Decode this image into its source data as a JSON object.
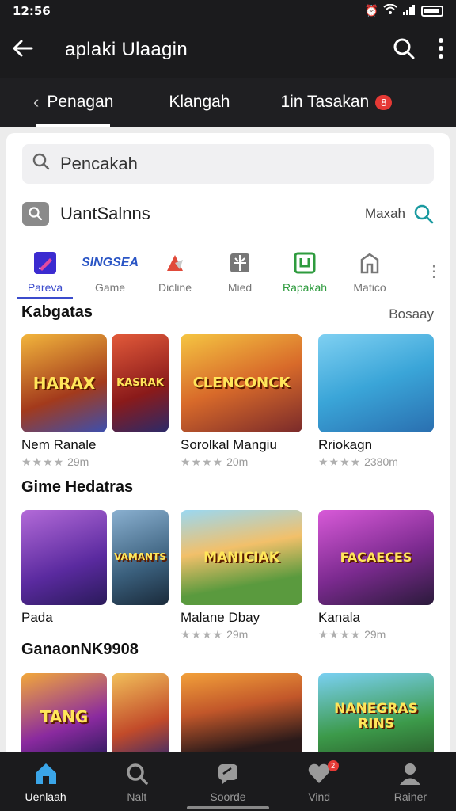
{
  "status": {
    "time": "12:56"
  },
  "app_bar": {
    "title": "aplaki Ulaagin"
  },
  "tabs": [
    {
      "label": "Penagan"
    },
    {
      "label": "Klangah"
    },
    {
      "label": "1in Tasakan",
      "badge": "8"
    }
  ],
  "search": {
    "value": "Pencakah"
  },
  "filter": {
    "label": "UantSalnns",
    "more_label": "Maxah"
  },
  "categories": [
    {
      "label": "Pareva",
      "icon": "pen-icon"
    },
    {
      "label": "Game",
      "logo": "SINGSEA"
    },
    {
      "label": "Dicline",
      "icon": "flag-icon"
    },
    {
      "label": "Mied",
      "icon": "grid-icon"
    },
    {
      "label": "Rapakah",
      "icon": "app-icon"
    },
    {
      "label": "Matico",
      "icon": "house-icon"
    }
  ],
  "sections": [
    {
      "title": "Kabgatas",
      "link": "Bosaay",
      "games": [
        {
          "name": "Nem Ranale",
          "rating": "★★★★",
          "count": "29m",
          "art": [
            "HARAX",
            "KASRAK"
          ],
          "colors": [
            "#d9882a",
            "#b42a2a"
          ]
        },
        {
          "name": "Sorolkal Mangiu",
          "rating": "★★★★",
          "count": "20m",
          "art": [
            "CLENCONCK"
          ],
          "colors": [
            "#e3a12b"
          ]
        },
        {
          "name": "Rriokagn",
          "rating": "★★★★",
          "count": "2380m",
          "art": [
            ""
          ],
          "colors": [
            "#3aa5d8"
          ]
        }
      ]
    },
    {
      "title": "Gime Hedatras",
      "link": "",
      "games": [
        {
          "name": "Pada",
          "rating": "",
          "count": "",
          "art": [
            "",
            "VAMANTS"
          ],
          "colors": [
            "#6f3bbf",
            "#3a6f9c"
          ]
        },
        {
          "name": "Malane Dbay",
          "rating": "★★★★",
          "count": "29m",
          "art": [
            "MANICIAK"
          ],
          "colors": [
            "#5a9a3e"
          ]
        },
        {
          "name": "Kanala",
          "rating": "★★★★",
          "count": "29m",
          "art": [
            "FACAECES"
          ],
          "colors": [
            "#7b2a8f"
          ]
        }
      ]
    },
    {
      "title": "GanaonNK9908",
      "link": "",
      "games": [
        {
          "name": "",
          "rating": "",
          "count": "",
          "art": [
            "TANG",
            ""
          ],
          "colors": [
            "#8a2a9f",
            "#c24b2a"
          ]
        },
        {
          "name": "",
          "rating": "",
          "count": "",
          "art": [
            ""
          ],
          "colors": [
            "#c2572a"
          ]
        },
        {
          "name": "",
          "rating": "",
          "count": "",
          "art": [
            "NANEGRAS RINS"
          ],
          "colors": [
            "#3c9a4a"
          ]
        }
      ]
    }
  ],
  "bottom_nav": [
    {
      "label": "Uenlaah",
      "icon": "home-icon"
    },
    {
      "label": "Nalt",
      "icon": "search-icon"
    },
    {
      "label": "Soorde",
      "icon": "chat-icon"
    },
    {
      "label": "Vind",
      "icon": "heart-icon",
      "badge": "2"
    },
    {
      "label": "Rainer",
      "icon": "profile-icon"
    }
  ],
  "colors": {
    "accent": "#3b4bcc",
    "badge": "#e53935",
    "bar": "#1b1b1d"
  }
}
